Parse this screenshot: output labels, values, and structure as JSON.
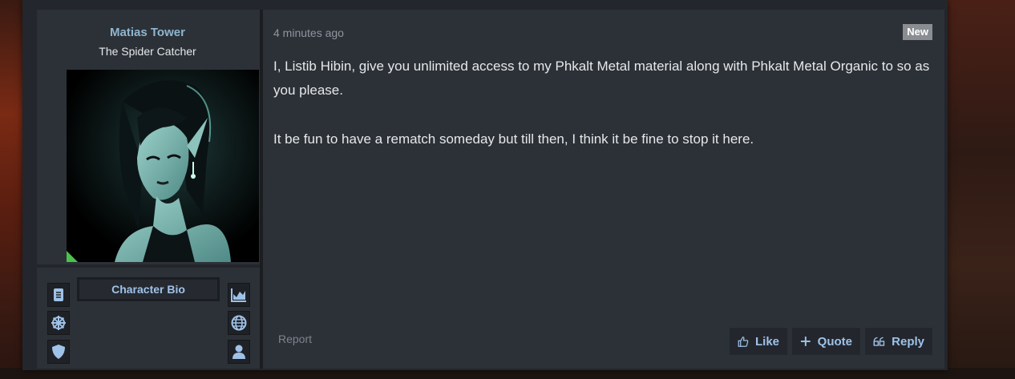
{
  "user": {
    "name": "Matias Tower",
    "title": "The Spider Catcher",
    "bio_button": "Character Bio",
    "online": true
  },
  "post": {
    "timestamp": "4 minutes ago",
    "badge": "New",
    "paragraphs": [
      "I, Listib Hibin, give you unlimited access to my Phkalt Metal material along with Phkalt Metal Organic to so as you please.",
      "It be fun to have a rematch someday but till then, I think it be fine to stop it here."
    ],
    "report_label": "Report",
    "actions": {
      "like": "Like",
      "quote": "Quote",
      "reply": "Reply"
    }
  },
  "icons": {
    "left": [
      "book-icon",
      "dharma-wheel-icon",
      "shield-icon"
    ],
    "right": [
      "chart-icon",
      "globe-icon",
      "user-icon"
    ]
  },
  "colors": {
    "accent": "#9fc2e8",
    "username": "#8fb6cf",
    "online": "#4bc34a",
    "badge": "#8a8d91"
  }
}
